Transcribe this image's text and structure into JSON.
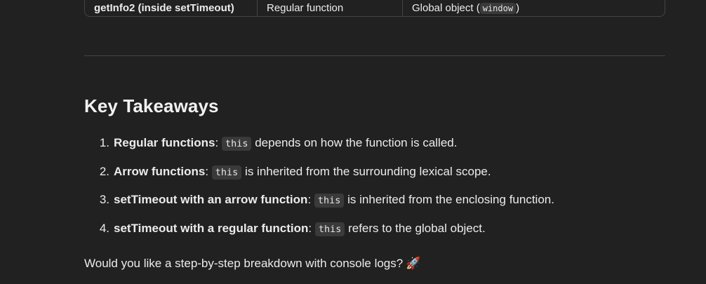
{
  "table_row": {
    "col1": "getInfo2 (inside setTimeout)",
    "col2": "Regular function",
    "col3_prefix": "Global object (",
    "col3_code": "window",
    "col3_suffix": ")"
  },
  "heading": "Key Takeaways",
  "takeaways": [
    {
      "num": "1.",
      "bold": "Regular functions",
      "sep": ": ",
      "code": "this",
      "rest": " depends on how the function is called."
    },
    {
      "num": "2.",
      "bold": "Arrow functions",
      "sep": ": ",
      "code": "this",
      "rest": " is inherited from the surrounding lexical scope."
    },
    {
      "num": "3.",
      "bold": "setTimeout with an arrow function",
      "sep": ": ",
      "code": "this",
      "rest": " is inherited from the enclosing function."
    },
    {
      "num": "4.",
      "bold": "setTimeout with a regular function",
      "sep": ": ",
      "code": "this",
      "rest": " refers to the global object."
    }
  ],
  "closing": "Would you like a step-by-step breakdown with console logs?",
  "closing_emoji": "🚀"
}
